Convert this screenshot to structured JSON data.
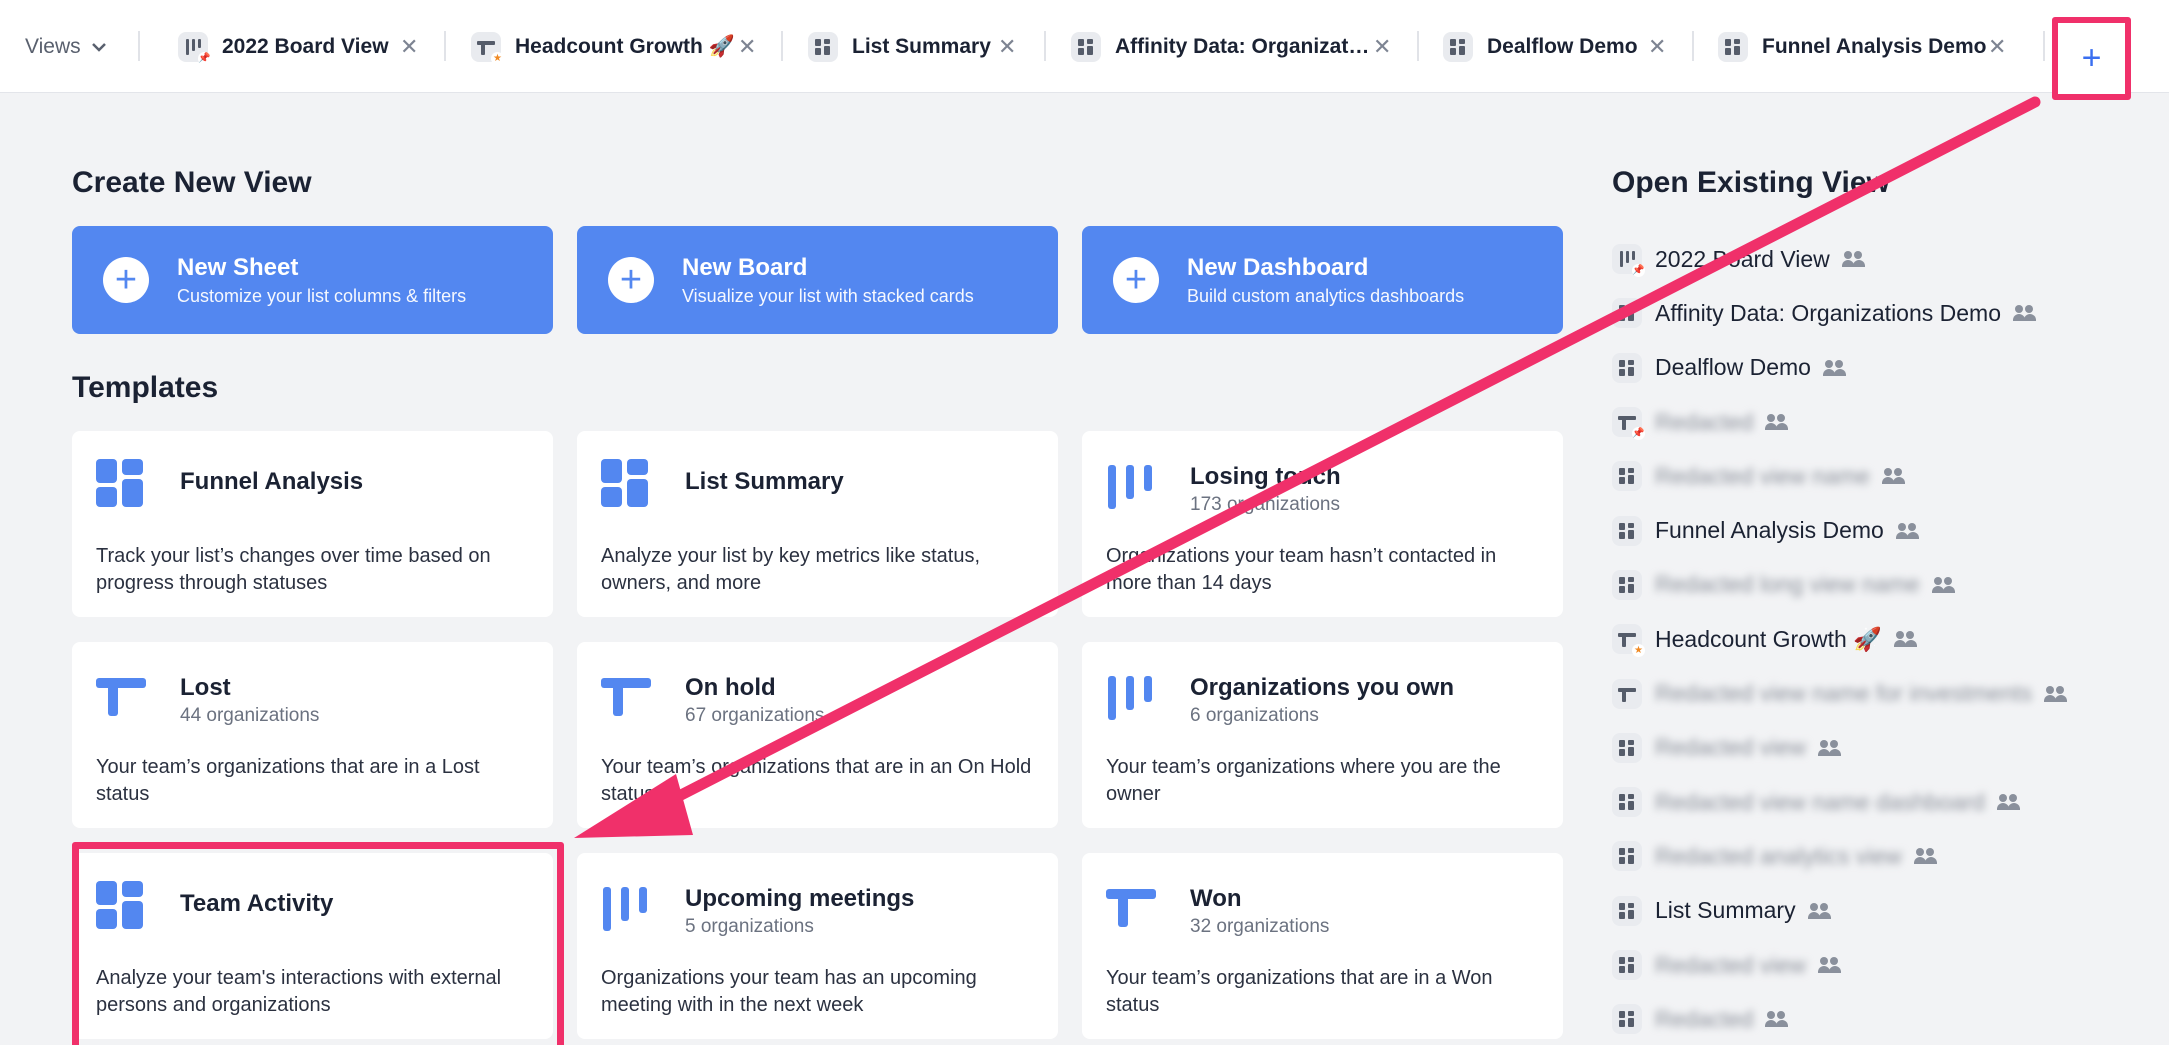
{
  "tabbar": {
    "views_label": "Views",
    "tabs": [
      {
        "label": "2022 Board View",
        "icon": "board-icon"
      },
      {
        "label": "Headcount Growth 🚀",
        "icon": "sheet-icon"
      },
      {
        "label": "List Summary",
        "icon": "dashboard-icon"
      },
      {
        "label": "Affinity Data: Organizat…",
        "icon": "dashboard-icon"
      },
      {
        "label": "Dealflow Demo",
        "icon": "dashboard-icon"
      },
      {
        "label": "Funnel Analysis Demo",
        "icon": "dashboard-icon"
      }
    ],
    "close_glyph": "✕",
    "add_glyph": "+"
  },
  "create": {
    "title": "Create New View",
    "buttons": [
      {
        "name": "New Sheet",
        "desc": "Customize your list columns & filters"
      },
      {
        "name": "New Board",
        "desc": "Visualize your list with stacked cards"
      },
      {
        "name": "New Dashboard",
        "desc": "Build custom analytics dashboards"
      }
    ]
  },
  "templates": {
    "title": "Templates",
    "cards": [
      {
        "name": "Funnel Analysis",
        "sub": "",
        "desc": "Track your list’s changes over time based on progress through statuses",
        "icon": "dashboard-icon"
      },
      {
        "name": "List Summary",
        "sub": "",
        "desc": "Analyze your list by key metrics like status, owners, and more",
        "icon": "dashboard-icon"
      },
      {
        "name": "Losing touch",
        "sub": "173 organizations",
        "desc": "Organizations your team hasn’t contacted in more than 14 days",
        "icon": "board-icon"
      },
      {
        "name": "Lost",
        "sub": "44 organizations",
        "desc": "Your team’s organizations that are in a Lost status",
        "icon": "sheet-icon"
      },
      {
        "name": "On hold",
        "sub": "67 organizations",
        "desc": "Your team’s organizations that are in an On Hold status",
        "icon": "sheet-icon"
      },
      {
        "name": "Organizations you own",
        "sub": "6 organizations",
        "desc": "Your team’s organizations where you are the owner",
        "icon": "board-icon"
      },
      {
        "name": "Team Activity",
        "sub": "",
        "desc": "Analyze your team's interactions with external persons and organizations",
        "icon": "dashboard-icon"
      },
      {
        "name": "Upcoming meetings",
        "sub": "5 organizations",
        "desc": "Organizations your team has an upcoming meeting with in the next week",
        "icon": "board-icon"
      },
      {
        "name": "Won",
        "sub": "32 organizations",
        "desc": "Your team’s organizations that are in a Won status",
        "icon": "sheet-icon"
      }
    ]
  },
  "existing": {
    "title": "Open Existing View",
    "items": [
      {
        "label": "2022 Board View",
        "icon": "board-icon",
        "blurred": false
      },
      {
        "label": "Affinity Data: Organizations Demo",
        "icon": "dashboard-icon",
        "blurred": false
      },
      {
        "label": "Dealflow Demo",
        "icon": "dashboard-icon",
        "blurred": false
      },
      {
        "label": "Redacted",
        "icon": "sheet-icon",
        "blurred": true
      },
      {
        "label": "Redacted view name",
        "icon": "dashboard-icon",
        "blurred": true
      },
      {
        "label": "Funnel Analysis Demo",
        "icon": "dashboard-icon",
        "blurred": false
      },
      {
        "label": "Redacted long view name",
        "icon": "dashboard-icon",
        "blurred": true
      },
      {
        "label": "Headcount Growth 🚀",
        "icon": "sheet-icon",
        "blurred": false
      },
      {
        "label": "Redacted view name for investments",
        "icon": "sheet-icon",
        "blurred": true
      },
      {
        "label": "Redacted view",
        "icon": "dashboard-icon",
        "blurred": false,
        "blur": true
      },
      {
        "label": "Redacted view name dashboard",
        "icon": "dashboard-icon",
        "blurred": true
      },
      {
        "label": "Redacted analytics view",
        "icon": "dashboard-icon",
        "blurred": true
      },
      {
        "label": "List Summary",
        "icon": "dashboard-icon",
        "blurred": false
      },
      {
        "label": "Redacted view",
        "icon": "dashboard-icon",
        "blurred": true
      },
      {
        "label": "Redacted",
        "icon": "dashboard-icon",
        "blurred": true
      }
    ]
  },
  "colors": {
    "accent": "#5387f0",
    "highlight": "#f0306a"
  }
}
